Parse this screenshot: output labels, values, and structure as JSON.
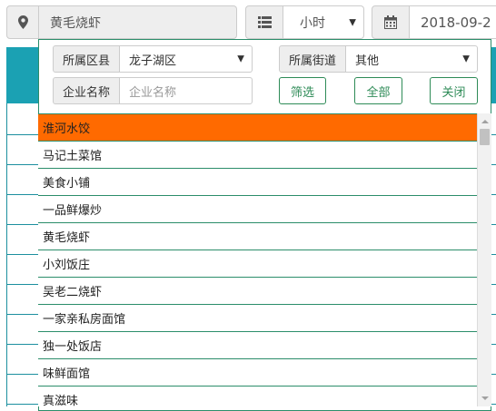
{
  "toolbar": {
    "location_value": "黄毛烧虾",
    "list_icon": "list-icon",
    "unit_value": "小时",
    "calendar_icon": "calendar-icon",
    "date_value": "2018-09-2"
  },
  "filter": {
    "district_label": "所属区县",
    "district_value": "龙子湖区",
    "street_label": "所属街道",
    "street_value": "其他",
    "company_label": "企业名称",
    "company_placeholder": "企业名称",
    "btn_filter": "筛选",
    "btn_all": "全部",
    "btn_close": "关闭"
  },
  "restaurants": [
    "淮河水饺",
    "马记土菜馆",
    "美食小铺",
    "一品鲜爆炒",
    "黄毛烧虾",
    "小刘饭庄",
    "吴老二烧虾",
    "一家亲私房面馆",
    "独一处饭店",
    "味鲜面馆",
    "真滋味"
  ],
  "selected_index": 0,
  "colors": {
    "accent_teal": "#1ba1b3",
    "active_orange": "#ff6a00",
    "button_green": "#2e8b57"
  }
}
